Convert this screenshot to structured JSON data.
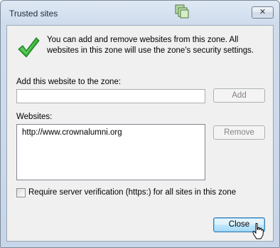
{
  "window": {
    "title": "Trusted sites",
    "close_glyph": "✕"
  },
  "info": {
    "text": "You can add and remove websites from this zone. All websites in this zone will use the zone's security settings."
  },
  "add_site": {
    "label": "Add this website to the zone:",
    "value": "",
    "button_label": "Add"
  },
  "websites": {
    "label": "Websites:",
    "items": [
      "http://www.crownalumni.org"
    ],
    "remove_label": "Remove"
  },
  "verification": {
    "label": "Require server verification (https:) for all sites in this zone",
    "checked": false
  },
  "footer": {
    "close_label": "Close"
  },
  "colors": {
    "accent_check": "#2fa82f",
    "title_frame": "#cfdcec"
  }
}
